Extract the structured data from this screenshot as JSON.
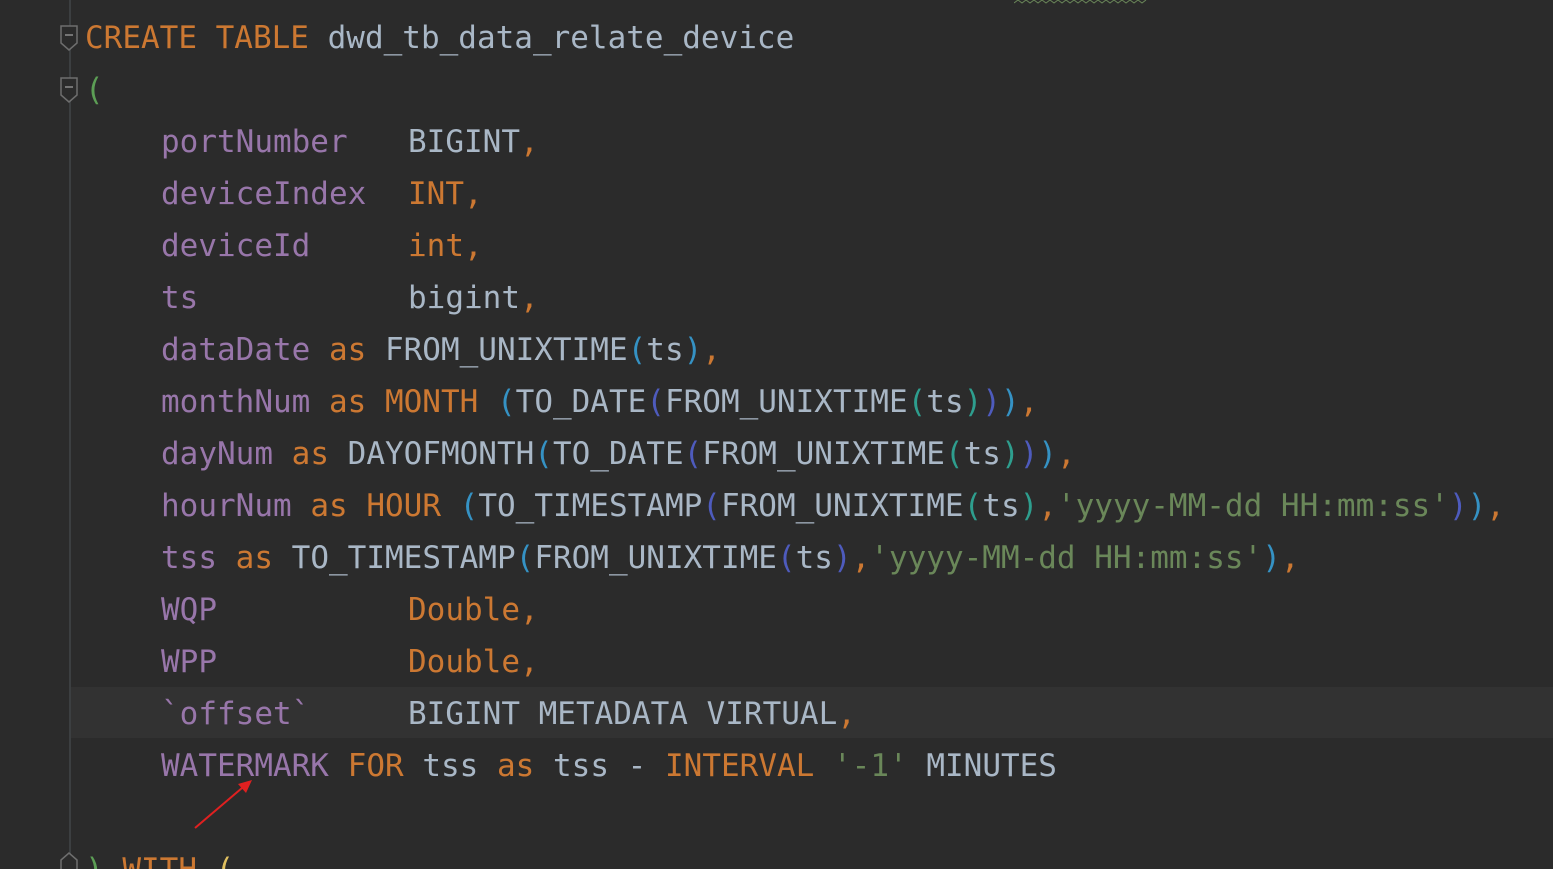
{
  "editor": {
    "language": "SQL",
    "colors": {
      "background": "#2b2b2b",
      "keyword": "#cc7832",
      "identifier": "#a9b7c6",
      "column": "#9876aa",
      "string": "#6a8759",
      "annotation_arrow": "#e02020"
    },
    "lines": {
      "l1": {
        "kw1": "CREATE TABLE",
        "name": "dwd_tb_data_relate_device"
      },
      "l2": {
        "paren": "("
      },
      "l3": {
        "col": "portNumber",
        "type": "BIGINT",
        "comma": ","
      },
      "l4": {
        "col": "deviceIndex",
        "type": "INT",
        "comma": ","
      },
      "l5": {
        "col": "deviceId",
        "type": "int",
        "comma": ","
      },
      "l6": {
        "col": "ts",
        "type": "bigint",
        "comma": ","
      },
      "l7": {
        "col": "dataDate",
        "as": "as",
        "fn": "FROM_UNIXTIME",
        "arg": "ts",
        "comma": ","
      },
      "l8": {
        "col": "monthNum",
        "as": "as",
        "fn1": "MONTH",
        "fn2": "TO_DATE",
        "fn3": "FROM_UNIXTIME",
        "arg": "ts",
        "comma": ","
      },
      "l9": {
        "col": "dayNum",
        "as": "as",
        "fn1": "DAYOFMONTH",
        "fn2": "TO_DATE",
        "fn3": "FROM_UNIXTIME",
        "arg": "ts",
        "comma": ","
      },
      "l10": {
        "col": "hourNum",
        "as": "as",
        "fn1": "HOUR",
        "fn2": "TO_TIMESTAMP",
        "fn3": "FROM_UNIXTIME",
        "arg": "ts",
        "fmt": "'yyyy-MM-dd HH:mm:ss'",
        "comma": ","
      },
      "l11": {
        "col": "tss",
        "as": "as",
        "fn1": "TO_TIMESTAMP",
        "fn2": "FROM_UNIXTIME",
        "arg": "ts",
        "fmt": "'yyyy-MM-dd HH:mm:ss'",
        "comma": ","
      },
      "l12": {
        "col": "WQP",
        "type": "Double",
        "comma": ","
      },
      "l13": {
        "col": "WPP",
        "type": "Double",
        "comma": ","
      },
      "l14": {
        "col": "`offset`",
        "type": "BIGINT METADATA VIRTUAL",
        "comma": ","
      },
      "l15": {
        "col": "WATERMARK",
        "for": "FOR",
        "tss1": "tss",
        "as": "as",
        "tss2": "tss",
        "minus": "-",
        "interval": "INTERVAL",
        "value": "'-1'",
        "unit": "MINUTES"
      },
      "l16": {
        "close": ")",
        "with": "WITH",
        "paren": "("
      }
    }
  }
}
